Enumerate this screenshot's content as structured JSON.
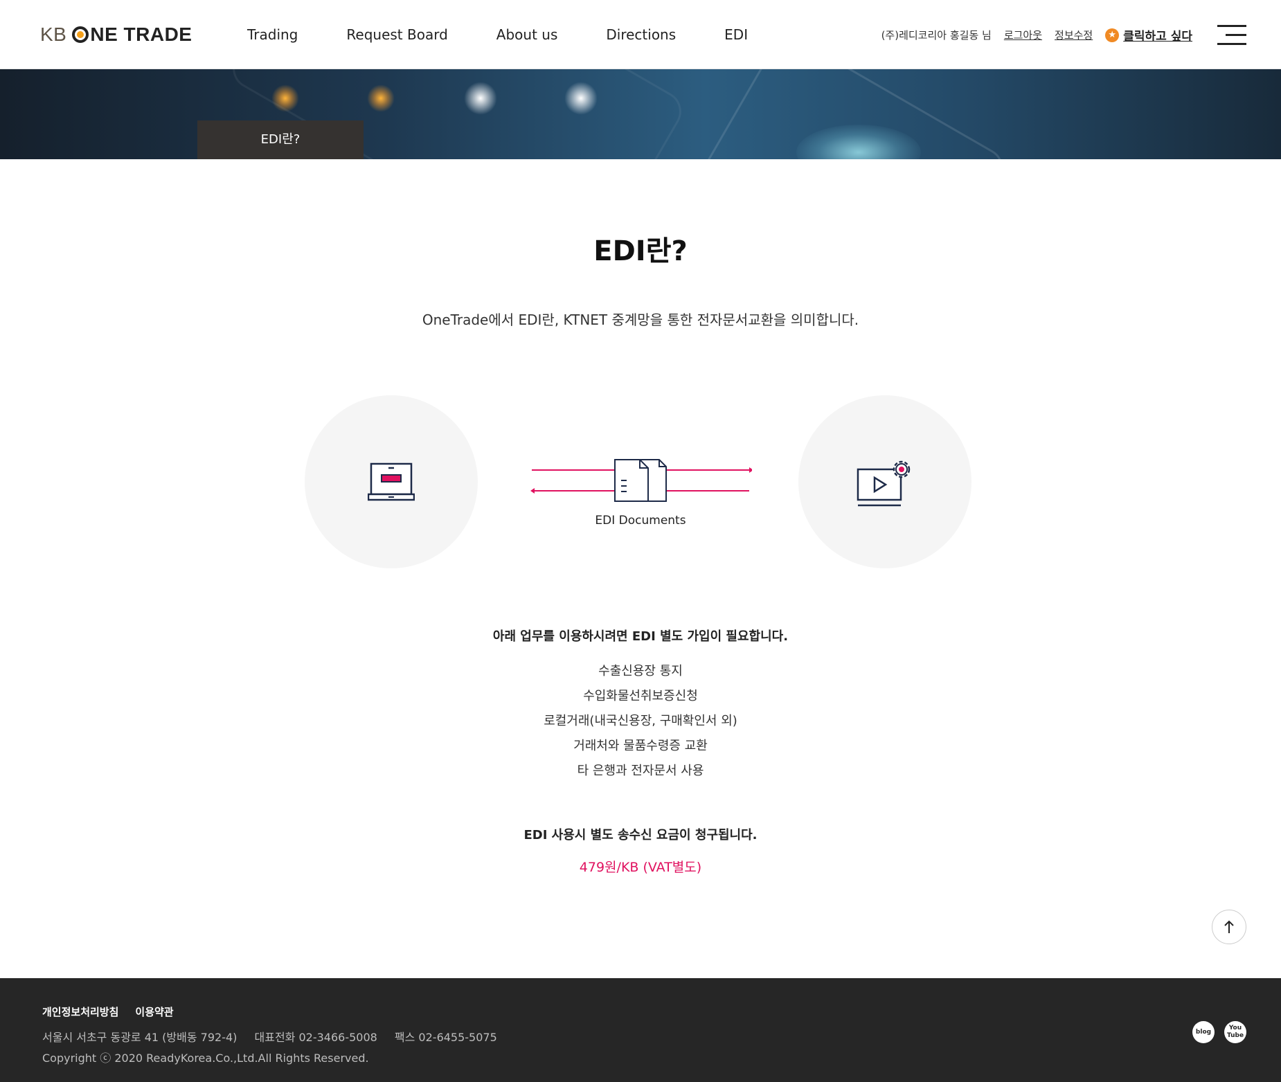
{
  "header": {
    "logo": {
      "prefix": "KB",
      "suffix": "NE TRADE"
    },
    "nav": [
      "Trading",
      "Request Board",
      "About us",
      "Directions",
      "EDI"
    ],
    "user": {
      "name": "(주)레디코리아 홍길동 님",
      "logout": "로그아웃",
      "edit_info": "정보수정",
      "favorite": "클릭하고 싶다",
      "favorite_icon": "star-icon"
    },
    "menu_icon": "hamburger-menu-icon"
  },
  "banner": {
    "tab_label": "EDI란?"
  },
  "main": {
    "title": "EDI란?",
    "intro": "OneTrade에서 EDI란, KTNET 중계망을 통한 전자문서교환을 의미합니다.",
    "diagram": {
      "left_icon": "laptop-icon",
      "center_icon": "documents-icon",
      "right_icon": "monitor-settings-icon",
      "center_label": "EDI Documents",
      "accent_color": "#e0115f",
      "line_color": "#1d2a48"
    },
    "notice": "아래 업무를 이용하시려면 EDI 별도 가입이 필요합니다.",
    "services": [
      "수출신용장 통지",
      "수입화물선취보증신청",
      "로컬거래(내국신용장, 구매확인서 외)",
      "거래처와 물품수령증 교환",
      "타 은행과 전자문서 사용"
    ],
    "fee_notice": "EDI 사용시 별도 송수신 요금이 청구됩니다.",
    "fee": "479원/KB (VAT별도)"
  },
  "top_button_icon": "arrow-up-icon",
  "footer": {
    "links": [
      "개인정보처리방침",
      "이용약관"
    ],
    "address": "서울시 서초구 동광로 41 (방배동 792-4)",
    "phone": "대표전화 02-3466-5008",
    "fax": "팩스 02-6455-5075",
    "copyright": "Copyright ⓒ 2020 ReadyKorea.Co.,Ltd.All Rights Reserved.",
    "social": [
      {
        "label": "blog",
        "icon": "blog-icon"
      },
      {
        "label": "You Tube",
        "icon": "youtube-icon"
      }
    ],
    "background": "#262626"
  }
}
